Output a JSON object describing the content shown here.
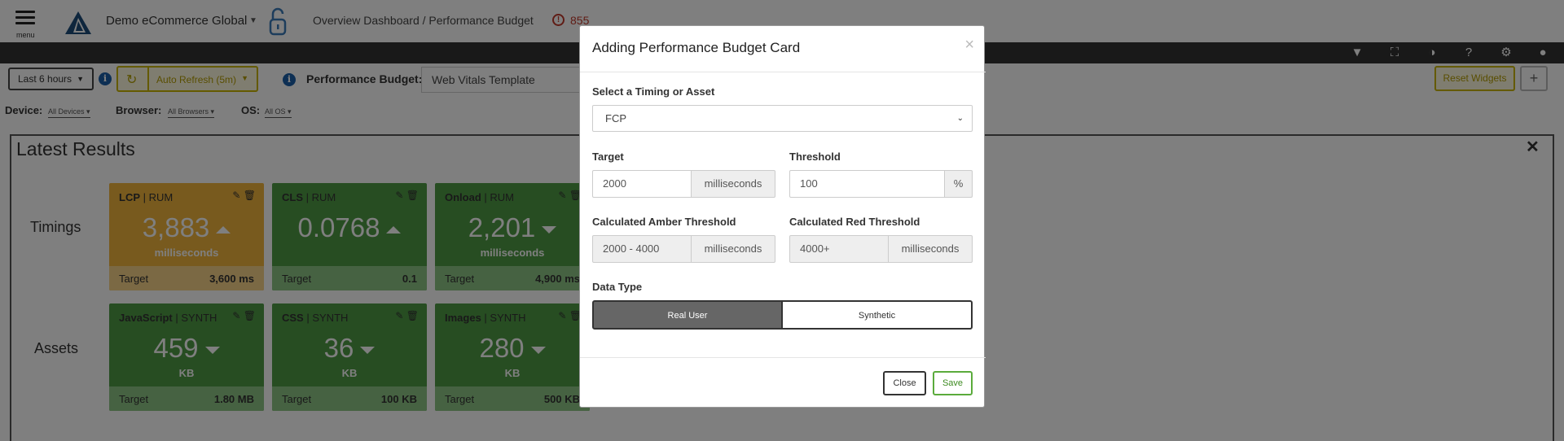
{
  "header": {
    "menu_label": "menu",
    "org_name": "Demo eCommerce Global",
    "breadcrumb": "Overview Dashboard / Performance Budget",
    "alert_count": "855"
  },
  "toolbar_icons": [
    "filter-icon",
    "fullscreen-icon",
    "contrast-icon",
    "help-icon",
    "settings-icon",
    "user-icon"
  ],
  "controls": {
    "time_range": "Last 6 hours",
    "auto_refresh": "Auto Refresh (5m)",
    "perf_budget_label": "Performance Budget:",
    "perf_budget_value": "Web Vitals Template",
    "reset_widgets": "Reset Widgets",
    "add_widget": "+"
  },
  "filters": {
    "device_label": "Device:",
    "device_value": "All Devices",
    "browser_label": "Browser:",
    "browser_value": "All Browsers",
    "os_label": "OS:",
    "os_value": "All OS"
  },
  "results": {
    "title": "Latest Results",
    "timings_label": "Timings",
    "assets_label": "Assets",
    "target_label": "Target",
    "cards": [
      {
        "metric": "LCP",
        "source": "RUM",
        "value": "3,883",
        "unit": "milliseconds",
        "target": "3,600 ms",
        "status": "amber",
        "trend": "up"
      },
      {
        "metric": "CLS",
        "source": "RUM",
        "value": "0.0768",
        "unit": "",
        "target": "0.1",
        "status": "green",
        "trend": "up"
      },
      {
        "metric": "Onload",
        "source": "RUM",
        "value": "2,201",
        "unit": "milliseconds",
        "target": "4,900 ms",
        "status": "green",
        "trend": "down"
      },
      {
        "metric": "JavaScript",
        "source": "SYNTH",
        "value": "459",
        "unit": "KB",
        "target": "1.80 MB",
        "status": "green",
        "trend": "down"
      },
      {
        "metric": "CSS",
        "source": "SYNTH",
        "value": "36",
        "unit": "KB",
        "target": "100 KB",
        "status": "green",
        "trend": "down"
      },
      {
        "metric": "Images",
        "source": "SYNTH",
        "value": "280",
        "unit": "KB",
        "target": "500 KB",
        "status": "green",
        "trend": "down"
      }
    ]
  },
  "modal": {
    "title": "Adding Performance Budget Card",
    "close_x": "×",
    "select_label": "Select a Timing or Asset",
    "select_value": "FCP",
    "target_label": "Target",
    "target_value": "2000",
    "target_unit": "milliseconds",
    "threshold_label": "Threshold",
    "threshold_value": "100",
    "threshold_unit": "%",
    "amber_label": "Calculated Amber Threshold",
    "amber_value": "2000 - 4000",
    "amber_unit": "milliseconds",
    "red_label": "Calculated Red Threshold",
    "red_value": "4000+",
    "red_unit": "milliseconds",
    "data_type_label": "Data Type",
    "data_type_options": [
      "Real User",
      "Synthetic"
    ],
    "data_type_selected": "Real User",
    "close_button": "Close",
    "save_button": "Save"
  }
}
